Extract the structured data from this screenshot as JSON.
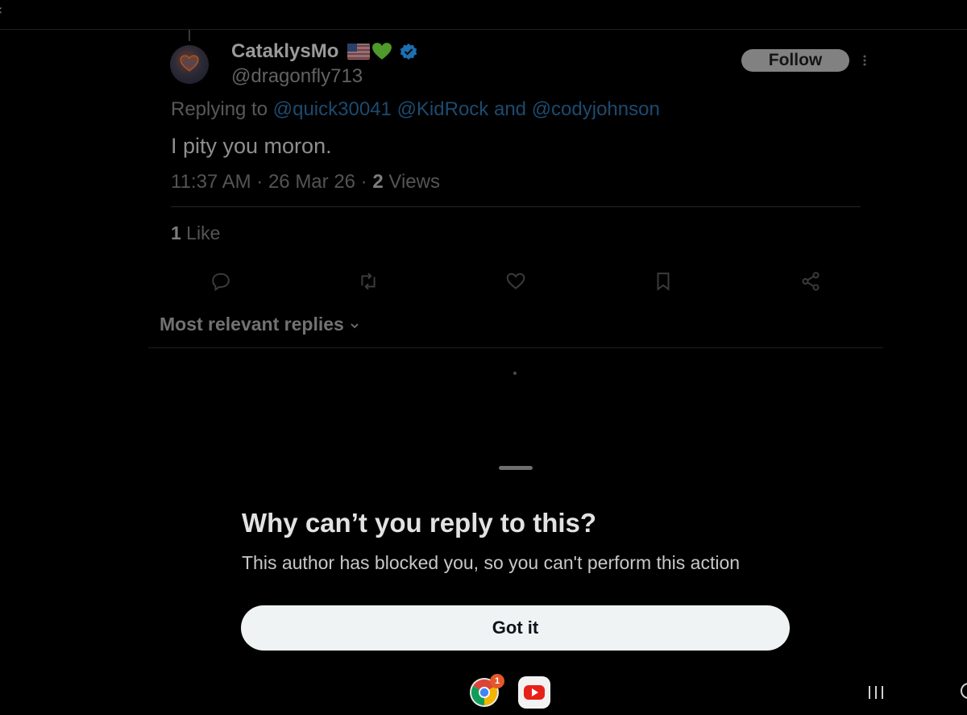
{
  "tweet": {
    "display_name": "CataklysMo",
    "handle": "@dragonfly713",
    "follow_label": "Follow",
    "replying_prefix": "Replying to ",
    "mention_1": "@quick30041",
    "mention_2": "@KidRock",
    "and_word": " and ",
    "mention_3": "@codyjohnson",
    "text": "I pity you moron.",
    "timestamp": "11:37 AM · 26 Mar 26 · ",
    "views_count": "2",
    "views_label": " Views",
    "likes_count": "1",
    "likes_label": " Like"
  },
  "replies_sort_label": "Most relevant replies",
  "sheet": {
    "title": "Why can’t you reply to this?",
    "body": "This author has blocked you, so you can't perform this action",
    "button_label": "Got it"
  },
  "taskbar": {
    "chrome_badge": "1"
  },
  "icons": [
    "back-icon",
    "avatar",
    "flag-icon",
    "green-heart-icon",
    "verified-icon",
    "more-icon",
    "reply-icon",
    "retweet-icon",
    "like-icon",
    "bookmark-icon",
    "share-icon",
    "chevron-down-icon",
    "chrome-icon",
    "youtube-icon",
    "recents-icon",
    "home-icon"
  ],
  "colors": {
    "background": "#000000",
    "link": "#1d4a6f",
    "button": "#eff3f4",
    "verified": "#1d9bf0"
  }
}
